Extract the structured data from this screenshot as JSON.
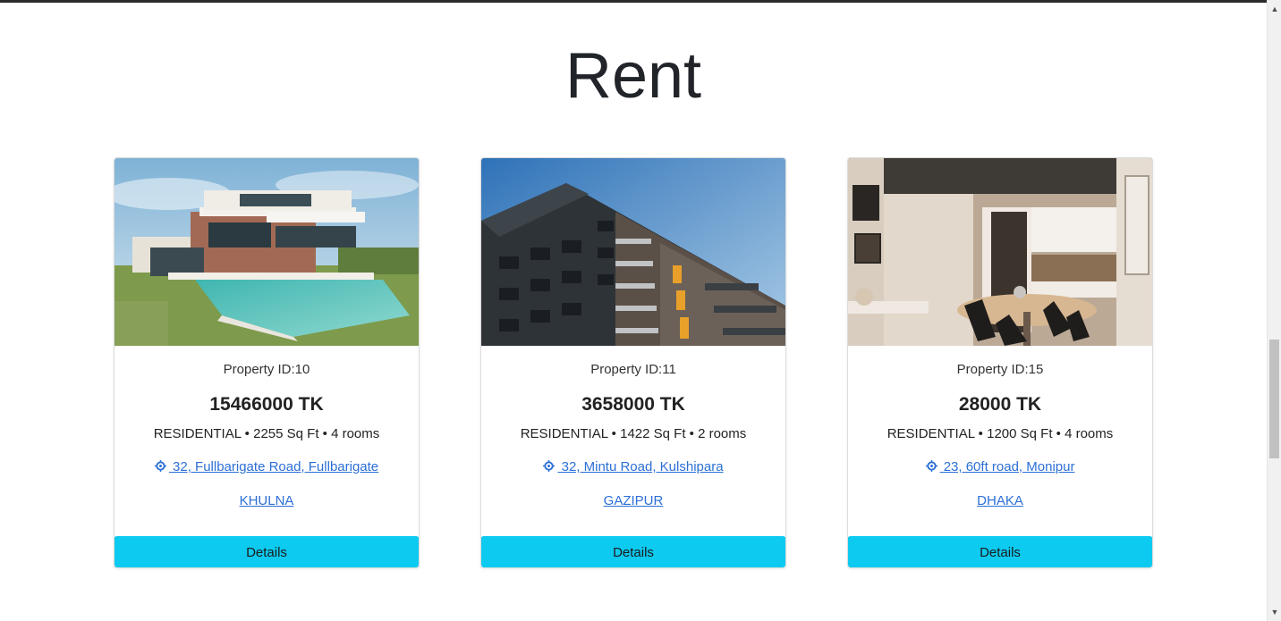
{
  "section": {
    "title": "Rent"
  },
  "properties": [
    {
      "id_label": "Property ID:10",
      "price": "15466000 TK",
      "meta": "RESIDENTIAL • 2255 Sq Ft • 4 rooms",
      "address": " 32, Fullbarigate Road, Fullbarigate",
      "city": "KHULNA",
      "button": "Details"
    },
    {
      "id_label": "Property ID:11",
      "price": "3658000 TK",
      "meta": "RESIDENTIAL • 1422 Sq Ft • 2 rooms",
      "address": " 32, Mintu Road, Kulshipara",
      "city": "GAZIPUR",
      "button": "Details"
    },
    {
      "id_label": "Property ID:15",
      "price": "28000 TK",
      "meta": "RESIDENTIAL • 1200 Sq Ft • 4 rooms",
      "address": " 23, 60ft road, Monipur",
      "city": "DHAKA",
      "button": "Details"
    }
  ],
  "icons": {
    "location": "location-crosshair-icon"
  },
  "colors": {
    "button": "#0dcaf0",
    "link": "#2c6fd6"
  }
}
